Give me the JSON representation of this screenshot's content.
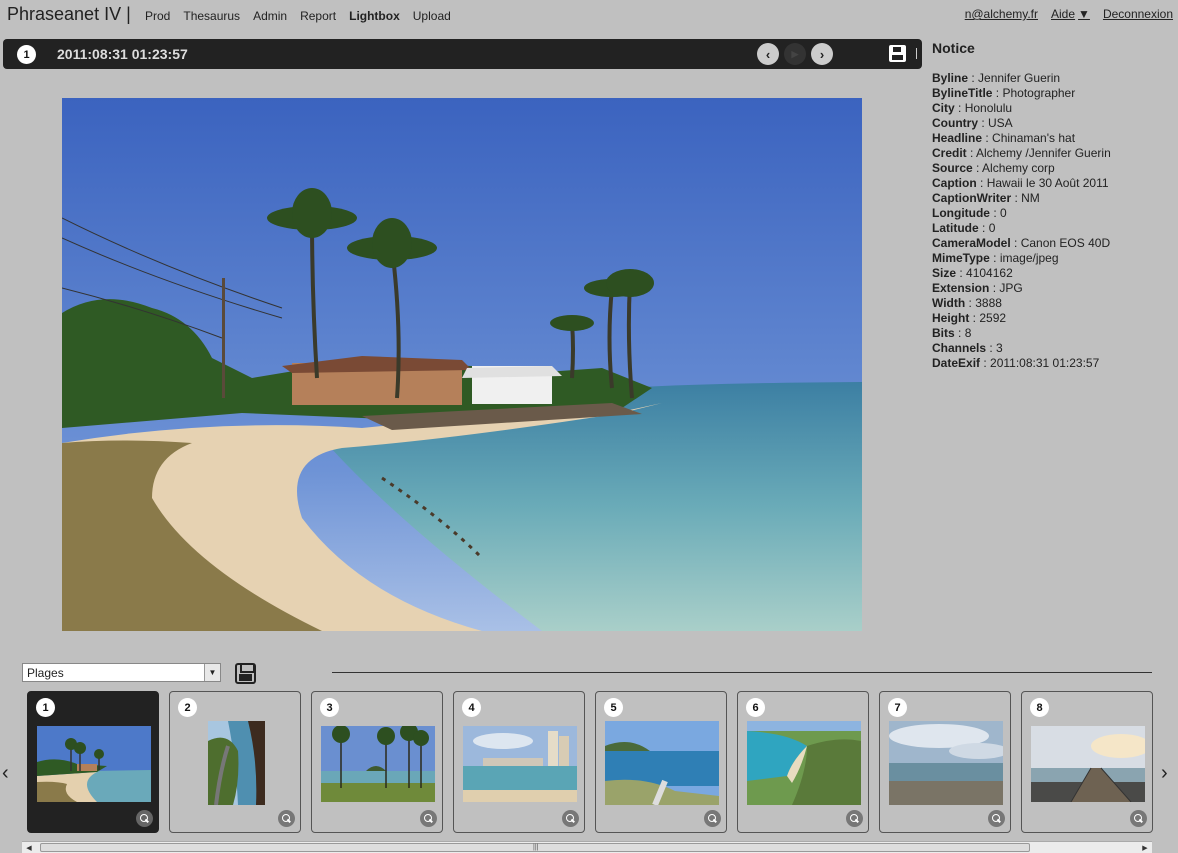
{
  "app": {
    "brand": "Phraseanet IV |",
    "nav": [
      "Prod",
      "Thesaurus",
      "Admin",
      "Report",
      "Lightbox",
      "Upload"
    ],
    "active_nav": "Lightbox",
    "user_email": "n@alchemy.fr",
    "help_label": "Aide",
    "logout_label": "Deconnexion"
  },
  "viewer": {
    "index": "1",
    "title": "2011:08:31 01:23:57",
    "prev_icon": "chevron-left-icon",
    "play_icon": "play-icon",
    "next_icon": "chevron-right-icon",
    "save_icon": "save-icon"
  },
  "notice": {
    "heading": "Notice",
    "fields": [
      {
        "key": "Byline",
        "value": "Jennifer Guerin"
      },
      {
        "key": "BylineTitle",
        "value": "Photographer"
      },
      {
        "key": "City",
        "value": "Honolulu"
      },
      {
        "key": "Country",
        "value": "USA"
      },
      {
        "key": "Headline",
        "value": "Chinaman's hat"
      },
      {
        "key": "Credit",
        "value": "Alchemy /Jennifer Guerin"
      },
      {
        "key": "Source",
        "value": "Alchemy corp"
      },
      {
        "key": "Caption",
        "value": "Hawaii le 30 Août 2011"
      },
      {
        "key": "CaptionWriter",
        "value": "NM"
      },
      {
        "key": "Longitude",
        "value": "0"
      },
      {
        "key": "Latitude",
        "value": "0"
      },
      {
        "key": "CameraModel",
        "value": "Canon EOS 40D"
      },
      {
        "key": "MimeType",
        "value": "image/jpeg"
      },
      {
        "key": "Size",
        "value": "4104162"
      },
      {
        "key": "Extension",
        "value": "JPG"
      },
      {
        "key": "Width",
        "value": "3888"
      },
      {
        "key": "Height",
        "value": "2592"
      },
      {
        "key": "Bits",
        "value": "8"
      },
      {
        "key": "Channels",
        "value": "3"
      },
      {
        "key": "DateExif",
        "value": "2011:08:31 01:23:57"
      }
    ]
  },
  "basket": {
    "selected": "Plages"
  },
  "thumbnails": [
    {
      "n": "1",
      "selected": true,
      "scene": "beach-palms"
    },
    {
      "n": "2",
      "selected": false,
      "scene": "coast-road"
    },
    {
      "n": "3",
      "selected": false,
      "scene": "palms-island"
    },
    {
      "n": "4",
      "selected": false,
      "scene": "waikiki"
    },
    {
      "n": "5",
      "selected": false,
      "scene": "cliff-sea"
    },
    {
      "n": "6",
      "selected": false,
      "scene": "bay-aerial"
    },
    {
      "n": "7",
      "selected": false,
      "scene": "cloudy-shore"
    },
    {
      "n": "8",
      "selected": false,
      "scene": "pier-sunset"
    }
  ],
  "colors": {
    "background": "#c0c0c0",
    "bar": "#222222",
    "sky": "#4a72c4",
    "sea": "#5fa6b8",
    "sand": "#e9d6b8"
  }
}
